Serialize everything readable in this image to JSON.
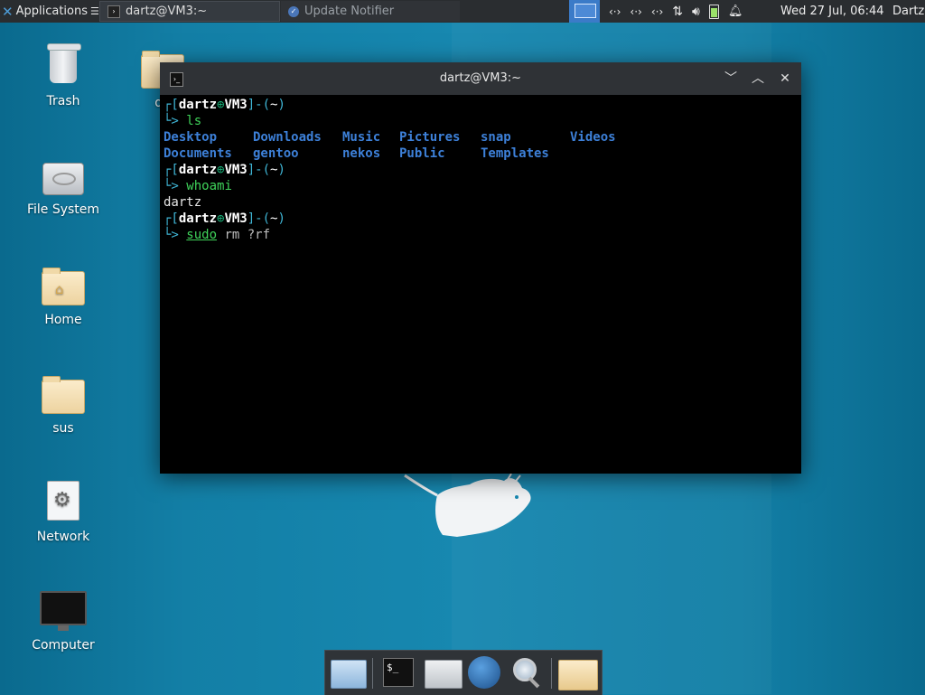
{
  "panel": {
    "applications_label": "Applications",
    "tasks": [
      {
        "label": "dartz@VM3:~"
      },
      {
        "label": "Update Notifier"
      }
    ],
    "clock": "Wed 27 Jul, 06:44",
    "user": "Dartz",
    "tray_icons": [
      "network-icon",
      "network-icon",
      "network-icon",
      "transfer-icon",
      "volume-icon",
      "battery-icon",
      "notification-bell-icon"
    ]
  },
  "desktop_icons": [
    {
      "label": "Trash",
      "icon": "trash-icon"
    },
    {
      "label": "File System",
      "icon": "drive-icon"
    },
    {
      "label": "Home",
      "icon": "home-folder-icon"
    },
    {
      "label": "sus",
      "icon": "folder-icon"
    },
    {
      "label": "Network",
      "icon": "network-gear-icon"
    },
    {
      "label": "Computer",
      "icon": "monitor-icon"
    },
    {
      "label": "da",
      "icon": "folder-icon"
    }
  ],
  "terminal": {
    "title": "dartz@VM3:~",
    "prompt": {
      "user": "dartz",
      "sep": "⊕",
      "host": "VM3",
      "path": "~"
    },
    "commands": [
      {
        "cmd": "ls",
        "args": ""
      },
      {
        "cmd": "whoami",
        "args": ""
      },
      {
        "cmd": "sudo",
        "args": "rm ?rf"
      }
    ],
    "ls_row1": [
      "Desktop",
      "Downloads",
      "Music",
      "Pictures",
      "snap",
      "Videos"
    ],
    "ls_row2": [
      "Documents",
      "gentoo",
      "nekos",
      "Public",
      "Templates"
    ],
    "whoami_output": "dartz"
  },
  "dock": {
    "items": [
      "show-desktop-icon",
      "terminal-icon",
      "home-files-icon",
      "web-browser-icon",
      "search-icon",
      "folder-icon"
    ],
    "terminal_glyph": "$_"
  }
}
